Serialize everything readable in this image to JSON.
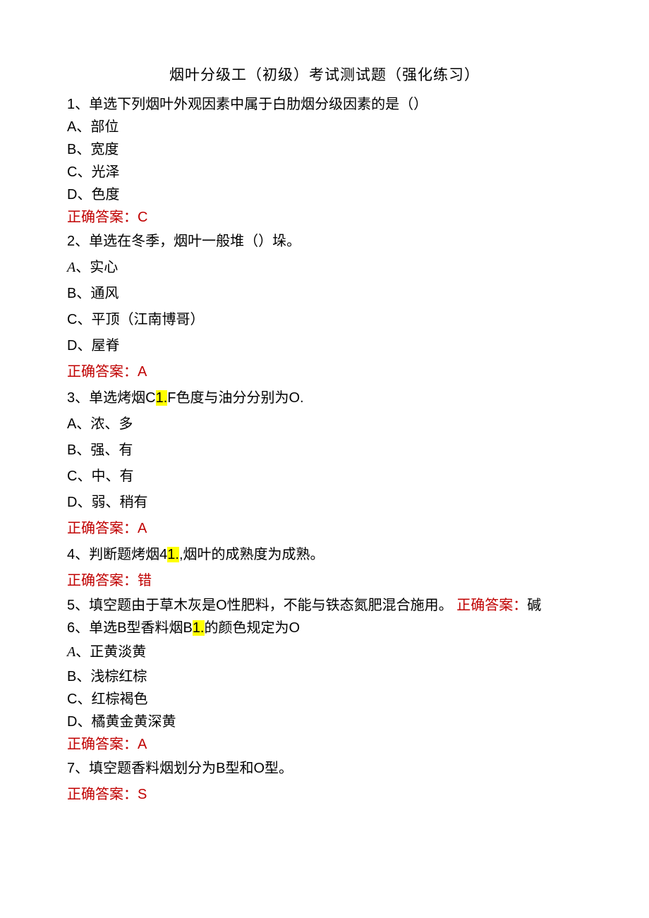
{
  "title": "烟叶分级工（初级）考试测试题（强化练习）",
  "answer_prefix": "正确答案：",
  "questions": [
    {
      "num": "1",
      "stem": "1、单选下列烟叶外观因素中属于白肋烟分级因素的是（）",
      "opts": [
        "A、部位",
        "B、宽度",
        "C、光泽",
        "D、色度"
      ],
      "answer": "C",
      "tight": true
    },
    {
      "num": "2",
      "stem": "2、单选在冬季，烟叶一般堆（）垛。",
      "opts_special": [
        {
          "pre": "",
          "italic": "A",
          "post": "、实心"
        },
        {
          "text": "B、通风"
        },
        {
          "text": "C、平顶（江南博哥）"
        },
        {
          "text": "D、屋脊"
        }
      ],
      "answer": "A"
    },
    {
      "num": "3",
      "stem_parts": [
        "3、单选烤烟C",
        "1.",
        "F色度与油分分别为O."
      ],
      "opts": [
        "A、浓、多",
        "B、强、有",
        "C、中、有",
        "D、弱、稍有"
      ],
      "answer": "A"
    },
    {
      "num": "4",
      "stem_parts": [
        "4、判断题烤烟4",
        "1.",
        ",烟叶的成熟度为成熟。"
      ],
      "answer": "错"
    },
    {
      "num": "5",
      "stem": "5、填空题由于草木灰是O性肥料，不能与铁态氮肥混合施用。",
      "inline_answer": "碱"
    },
    {
      "num": "6",
      "stem_parts": [
        "6、单选B型香料烟B",
        "1.",
        "的颜色规定为O"
      ],
      "opts_special": [
        {
          "pre": "",
          "italic": "A",
          "post": "、正黄淡黄"
        },
        {
          "text": "B、浅棕红棕"
        },
        {
          "text": "C、红棕褐色"
        },
        {
          "text": "D、橘黄金黄深黄"
        }
      ],
      "answer": "A",
      "tight_last": true
    },
    {
      "num": "7",
      "stem": "7、填空题香料烟划分为B型和O型。",
      "answer": "S"
    }
  ]
}
